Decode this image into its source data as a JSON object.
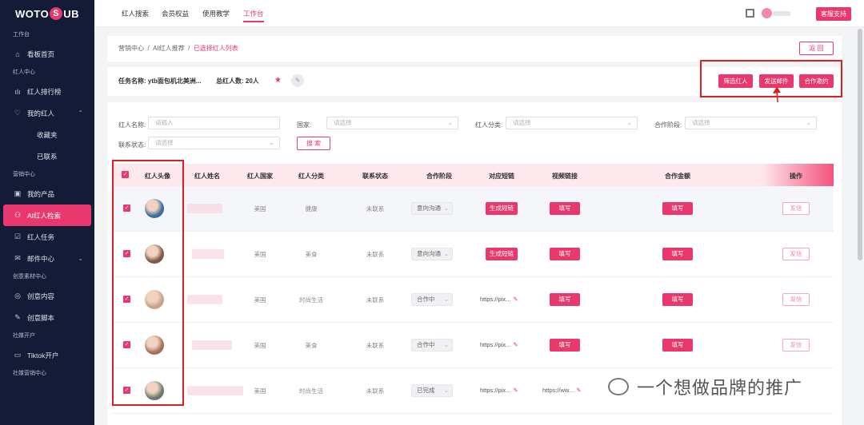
{
  "brand": {
    "logo_text_left": "WOTO",
    "logo_text_mid": "S",
    "logo_text_right": "UB"
  },
  "sidebar": {
    "sections": [
      {
        "title": "工作台",
        "items": [
          {
            "label": "看板首页",
            "icon": "home-icon"
          }
        ]
      },
      {
        "title": "红人中心",
        "items": [
          {
            "label": "红人排行榜",
            "icon": "bar-chart-icon"
          },
          {
            "label": "我的红人",
            "icon": "heart-icon",
            "expanded": true,
            "children": [
              "收藏夹",
              "已联系"
            ]
          }
        ]
      },
      {
        "title": "营销中心",
        "items": [
          {
            "label": "我的产品",
            "icon": "box-icon"
          },
          {
            "label": "AI红人检索",
            "icon": "user-search-icon",
            "active": true
          },
          {
            "label": "红人任务",
            "icon": "task-icon"
          },
          {
            "label": "邮件中心",
            "icon": "mail-icon",
            "expandable": true
          }
        ]
      },
      {
        "title": "创意素材中心",
        "items": [
          {
            "label": "创意内容",
            "icon": "palette-icon"
          },
          {
            "label": "创意脚本",
            "icon": "feather-icon"
          }
        ]
      },
      {
        "title": "社媒开户",
        "items": [
          {
            "label": "Tiktok开户",
            "icon": "ticket-icon"
          }
        ]
      },
      {
        "title": "社媒营销中心",
        "items": []
      }
    ]
  },
  "topbar": {
    "tabs": [
      "红人搜索",
      "会员权益",
      "使用教学",
      "工作台"
    ],
    "active_tab": "工作台",
    "support": "客服支持"
  },
  "breadcrumb": [
    "营销中心",
    "AI红人推荐",
    "已选择红人列表"
  ],
  "back_button": "返 回",
  "task": {
    "name_label": "任务名称:",
    "name_value": "ytb面包机北美洲...",
    "total_label": "总红人数:",
    "total_value": "20人"
  },
  "actions": [
    "筛选红人",
    "发送邮件",
    "合作邀约"
  ],
  "filters": {
    "name": {
      "label": "红人名称:",
      "placeholder": "请输入"
    },
    "country": {
      "label": "国家:",
      "placeholder": "请选择"
    },
    "category": {
      "label": "红人分类:",
      "placeholder": "请选择"
    },
    "stage": {
      "label": "合作阶段:",
      "placeholder": "请选择"
    },
    "status": {
      "label": "联系状态:",
      "placeholder": "请选择"
    },
    "search_button": "搜 索"
  },
  "table": {
    "headers": [
      "红人头像",
      "红人姓名",
      "红人国家",
      "红人分类",
      "联系状态",
      "合作阶段",
      "对应短链",
      "视频链接",
      "合作金额",
      "操作"
    ],
    "rows": [
      {
        "country": "美国",
        "category": "健康",
        "status": "未联系",
        "stage": "意向沟通",
        "shortlink": "生成短链",
        "video": "填写",
        "amount": "填写",
        "op": "发信",
        "avatar": "#3a6f9e"
      },
      {
        "country": "美国",
        "category": "美食",
        "status": "未联系",
        "stage": "意向沟通",
        "shortlink": "生成短链",
        "video": "填写",
        "amount": "填写",
        "op": "发信",
        "avatar": "#7a5a4a"
      },
      {
        "country": "美国",
        "category": "时尚生活",
        "status": "未联系",
        "stage": "合作中",
        "shortlink": "https://pix...",
        "video": "填写",
        "amount": "填写",
        "op": "发信",
        "avatar": "#c7a58a"
      },
      {
        "country": "美国",
        "category": "美食",
        "status": "未联系",
        "stage": "合作中",
        "shortlink": "https://pix...",
        "video": "填写",
        "amount": "填写",
        "op": "发信",
        "avatar": "#a8705c"
      },
      {
        "country": "美国",
        "category": "时尚生活",
        "status": "未联系",
        "stage": "已完成",
        "shortlink": "https://pix...",
        "video": "https://ww...",
        "amount": "",
        "op": "",
        "avatar": "#6d7a6a"
      }
    ]
  },
  "watermark": "一个想做品牌的推广",
  "colors": {
    "accent": "#e8386d",
    "sidebar_bg": "#141b37",
    "highlight_box": "#e02020"
  }
}
